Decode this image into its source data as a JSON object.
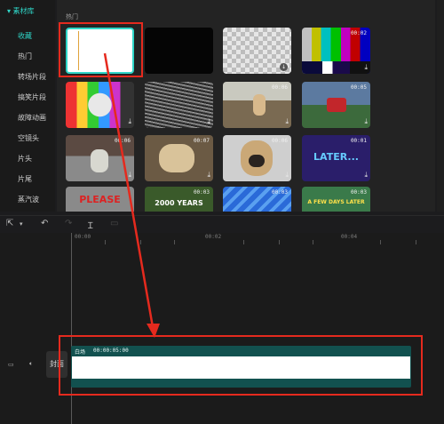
{
  "sidebar": {
    "header": "▾ 素材库",
    "items": [
      {
        "label": "收藏",
        "active": true
      },
      {
        "label": "热门"
      },
      {
        "label": "转场片段"
      },
      {
        "label": "搞笑片段"
      },
      {
        "label": "故障动画"
      },
      {
        "label": "空镜头"
      },
      {
        "label": "片头"
      },
      {
        "label": "片尾"
      },
      {
        "label": "蒸汽波"
      }
    ]
  },
  "library": {
    "section_label": "热门",
    "thumbs": [
      {
        "name": "white-clip",
        "duration": ""
      },
      {
        "name": "black-clip",
        "duration": ""
      },
      {
        "name": "transparent-clip",
        "duration": ""
      },
      {
        "name": "color-bars",
        "duration": "00:02"
      },
      {
        "name": "test-card",
        "duration": ""
      },
      {
        "name": "static-noise",
        "duration": ""
      },
      {
        "name": "dog-meme",
        "duration": "00:06"
      },
      {
        "name": "red-car",
        "duration": "00:05"
      },
      {
        "name": "cat-meme",
        "duration": "00:06"
      },
      {
        "name": "plush-dog",
        "duration": "00:07"
      },
      {
        "name": "pug",
        "duration": "00:06"
      },
      {
        "name": "later-title",
        "duration": "00:01",
        "text": "LATER..."
      },
      {
        "name": "please-sign",
        "duration": "",
        "text": "PLEASE"
      },
      {
        "name": "2000-years",
        "duration": "00:03",
        "text": "2000 YEARS"
      },
      {
        "name": "blue-clip",
        "duration": "00:03"
      },
      {
        "name": "few-days-later",
        "duration": "00:03",
        "text": "A FEW DAYS LATER"
      }
    ]
  },
  "toolbar": {
    "select_icon": "cursor-icon",
    "undo_icon": "undo-icon",
    "redo_icon": "redo-icon",
    "split_icon": "split-icon",
    "delete_icon": "delete-icon"
  },
  "timeline": {
    "ticks": [
      "00:00",
      "00:02",
      "00:04"
    ],
    "cover_label": "封面",
    "clip": {
      "label": "白场",
      "duration": "00:00:05:00"
    }
  }
}
